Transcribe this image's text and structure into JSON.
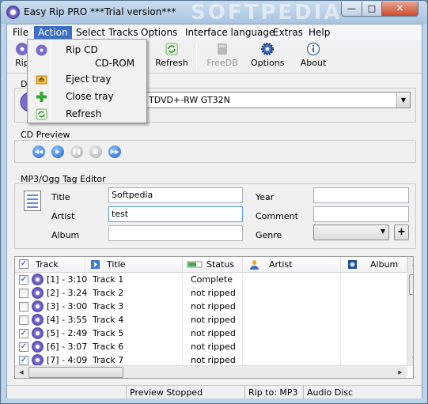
{
  "window": {
    "title": "Easy Rip PRO ***Trial version***",
    "watermark": "SOFTPEDIA",
    "min_label": "—",
    "max_label": "□",
    "close_label": "✕"
  },
  "menubar": [
    "File",
    "Action",
    "Select Tracks",
    "Options",
    "Interface language",
    "Extras",
    "Help"
  ],
  "toolbar": {
    "rip_label": "Rip",
    "refresh_label": "Refresh",
    "freedb_label": "FreeDB",
    "options_label": "Options",
    "about_label": "About"
  },
  "action_menu": {
    "rip_cd": "Rip CD",
    "submenu_title": "CD-ROM",
    "eject_tray": "Eject tray",
    "close_tray": "Close tray",
    "refresh": "Refresh"
  },
  "drive": {
    "label": "Driv",
    "selected": "TDVD+-RW GT32N"
  },
  "cd_preview": {
    "label": "CD Preview"
  },
  "tag_editor": {
    "label": "MP3/Ogg Tag Editor",
    "title_label": "Title",
    "title_value": "Softpedia",
    "artist_label": "Artist",
    "artist_value": "test",
    "album_label": "Album",
    "album_value": "",
    "year_label": "Year",
    "year_value": "",
    "comment_label": "Comment",
    "comment_value": "",
    "genre_label": "Genre",
    "genre_value": "",
    "add_label": "+"
  },
  "track_list": {
    "headers": {
      "track": "Track",
      "title": "Title",
      "status": "Status",
      "artist": "Artist",
      "album": "Album"
    },
    "rows": [
      {
        "checked": "✓",
        "track": "[1] - 3:10",
        "title": "Track 1",
        "status": "Complete"
      },
      {
        "checked": "",
        "track": "[2] - 3:24",
        "title": "Track 2",
        "status": "not ripped"
      },
      {
        "checked": "",
        "track": "[3] - 3:00",
        "title": "Track 3",
        "status": "not ripped"
      },
      {
        "checked": "",
        "track": "[4] - 3:55",
        "title": "Track 4",
        "status": "not ripped"
      },
      {
        "checked": "✓",
        "track": "[5] - 2:49",
        "title": "Track 5",
        "status": "not ripped"
      },
      {
        "checked": "✓",
        "track": "[6] - 3:07",
        "title": "Track 6",
        "status": "not ripped"
      },
      {
        "checked": "✓",
        "track": "[7] - 4:09",
        "title": "Track 7",
        "status": "not ripped"
      }
    ]
  },
  "statusbar": {
    "preview": "Preview Stopped",
    "rip_to": "Rip to: MP3",
    "source": "Audio Disc"
  }
}
